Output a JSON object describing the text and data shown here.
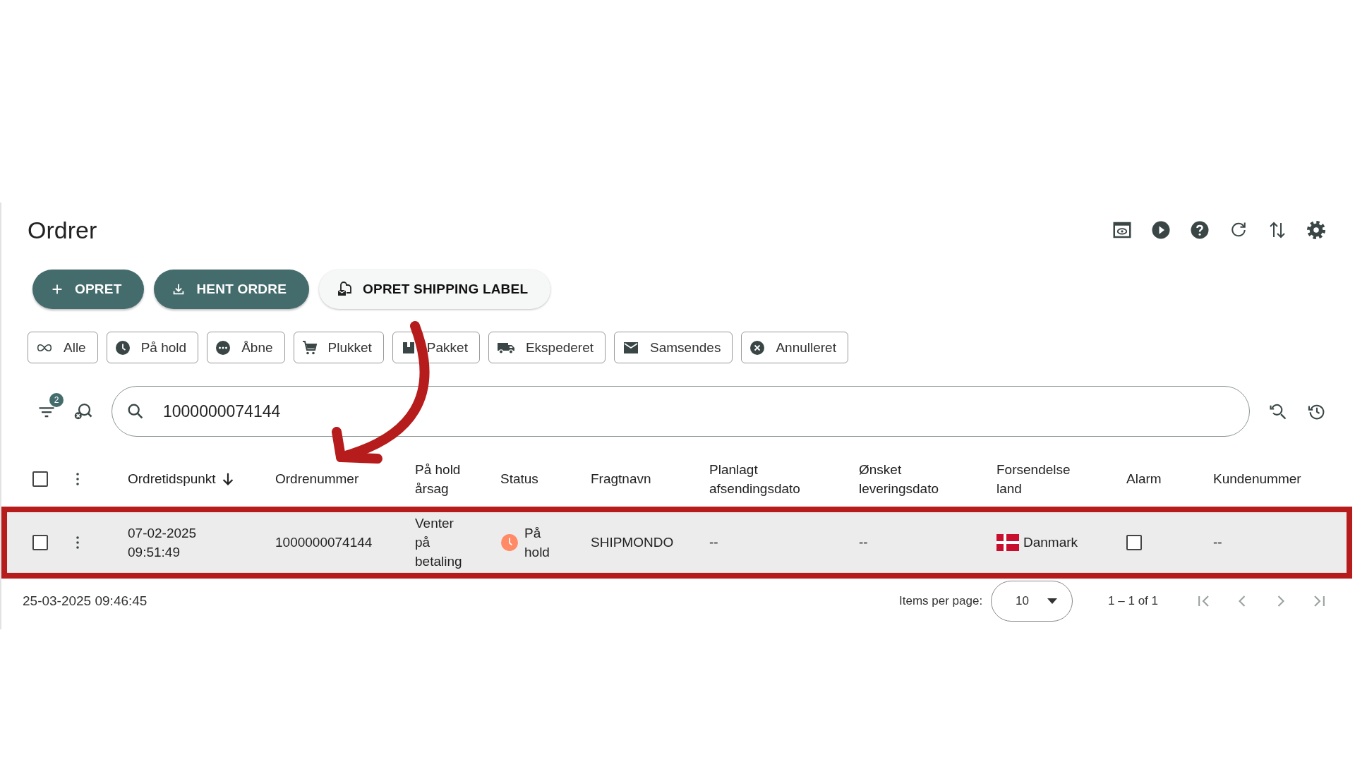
{
  "page": {
    "title": "Ordrer"
  },
  "buttons": [
    {
      "label": "OPRET",
      "kind": "primary"
    },
    {
      "label": "HENT ORDRE",
      "kind": "primary"
    },
    {
      "label": "OPRET SHIPPING LABEL",
      "kind": "secondary"
    }
  ],
  "status_filters": [
    {
      "label": "Alle"
    },
    {
      "label": "På hold"
    },
    {
      "label": "Åbne"
    },
    {
      "label": "Plukket"
    },
    {
      "label": "Pakket"
    },
    {
      "label": "Ekspederet"
    },
    {
      "label": "Samsendes"
    },
    {
      "label": "Annulleret"
    }
  ],
  "search": {
    "filter_count": "2",
    "value": "1000000074144"
  },
  "table": {
    "select_all_checked": false,
    "columns": [
      {
        "label": "Ordretidspunkt",
        "sorted": true
      },
      {
        "label": "Ordrenummer",
        "sorted": false
      },
      {
        "label": "På hold årsag",
        "sorted": false
      },
      {
        "label": "Status",
        "sorted": false
      },
      {
        "label": "Fragtnavn",
        "sorted": false
      },
      {
        "label": "Planlagt afsendingsdato",
        "sorted": false
      },
      {
        "label": "Ønsket leveringsdato",
        "sorted": false
      },
      {
        "label": "Forsendelse land",
        "sorted": false
      },
      {
        "label": "Alarm",
        "sorted": false
      },
      {
        "label": "Kundenummer",
        "sorted": false
      }
    ],
    "rows": [
      {
        "checked": false,
        "highlighted": true,
        "order_time": "07-02-2025 09:51:49",
        "order_number": "1000000074144",
        "hold_reason": "Venter på betaling",
        "status": "På hold",
        "carrier": "SHIPMONDO",
        "planned_ship_date": "--",
        "requested_delivery_date": "--",
        "country": "Danmark",
        "alarm_checked": false,
        "customer_number": "--"
      }
    ]
  },
  "footer": {
    "timestamp": "25-03-2025 09:46:45",
    "items_per_page_label": "Items per page:",
    "items_per_page": "10",
    "range": "1 – 1 of 1"
  }
}
